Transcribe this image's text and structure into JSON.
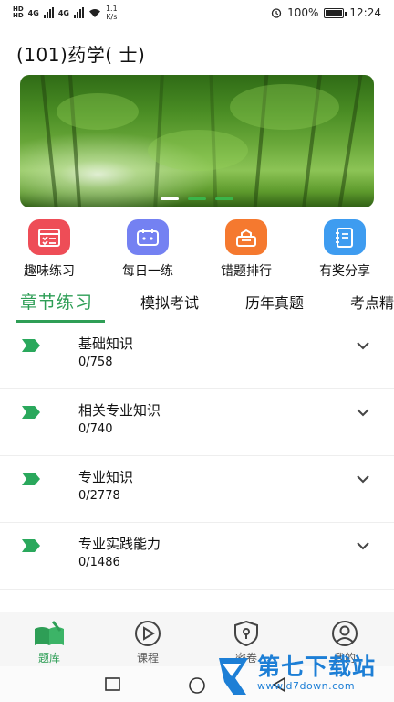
{
  "status_bar": {
    "hd1": "HD",
    "hd2": "HD",
    "net1": "4G",
    "net2": "4G",
    "speed_value": "1.1",
    "speed_unit": "K/s",
    "battery": "100%",
    "time": "12:24"
  },
  "page": {
    "title": "(101)药学( 士)"
  },
  "banner": {
    "slides": 3,
    "active_slide": 0
  },
  "quick_actions": [
    {
      "label": "趣味练习",
      "icon": "list-icon",
      "color": "#ee4d57"
    },
    {
      "label": "每日一练",
      "icon": "calendar-icon",
      "color": "#7481f2"
    },
    {
      "label": "错题排行",
      "icon": "ranking-icon",
      "color": "#f5792f"
    },
    {
      "label": "有奖分享",
      "icon": "notebook-icon",
      "color": "#3e9cf0"
    }
  ],
  "tabs": [
    {
      "label": "章节练习",
      "active": true
    },
    {
      "label": "模拟考试",
      "active": false
    },
    {
      "label": "历年真题",
      "active": false
    },
    {
      "label": "考点精",
      "active": false
    }
  ],
  "chapters": [
    {
      "name": "基础知识",
      "progress": "0/758"
    },
    {
      "name": "相关专业知识",
      "progress": "0/740"
    },
    {
      "name": "专业知识",
      "progress": "0/2778"
    },
    {
      "name": "专业实践能力",
      "progress": "0/1486"
    }
  ],
  "bottom_nav": [
    {
      "label": "题库",
      "icon": "book-icon",
      "active": true
    },
    {
      "label": "课程",
      "icon": "play-icon",
      "active": false
    },
    {
      "label": "密卷",
      "icon": "lock-shield-icon",
      "active": false
    },
    {
      "label": "我的",
      "icon": "user-icon",
      "active": false
    }
  ],
  "watermark": {
    "title": "第七下载站",
    "url": "www.d7down.com"
  },
  "colors": {
    "accent": "#2e9e56",
    "watermark": "#1d7fd6"
  }
}
